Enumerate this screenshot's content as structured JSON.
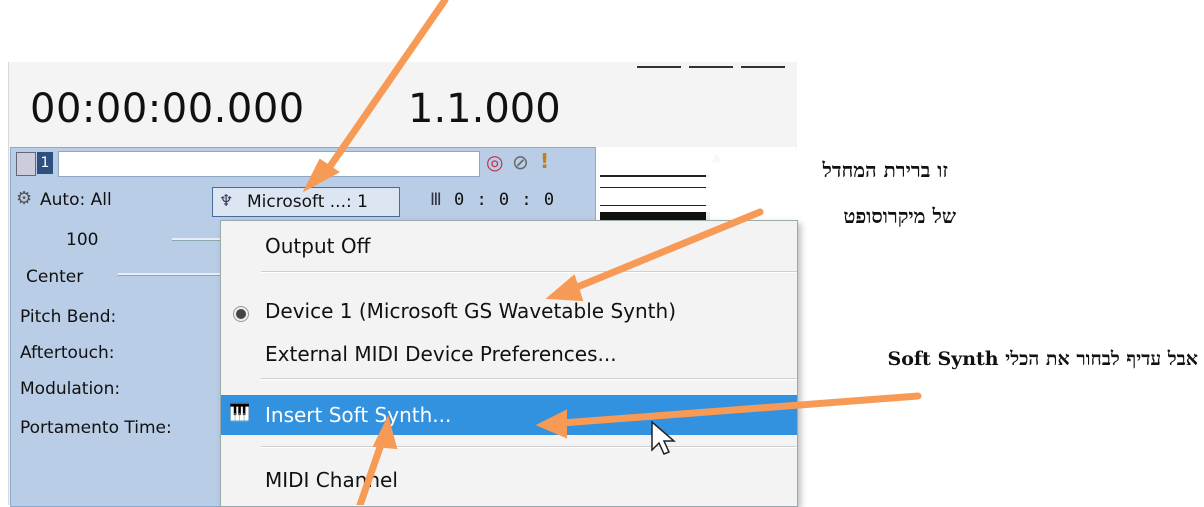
{
  "transport": {
    "time": "00:00:00.000",
    "measure": "1.1.000"
  },
  "track": {
    "auto_label": "Auto: All",
    "device_button": "Microsoft ...: 1",
    "counter": "0 : 0 : 0",
    "volume": "100",
    "pan": "Center",
    "params": [
      "Pitch Bend:",
      "Aftertouch:",
      "Modulation:",
      "Portamento Time:"
    ]
  },
  "menu": {
    "items": [
      {
        "label": "Output Off"
      },
      {
        "label": "Device 1  (Microsoft GS Wavetable Synth)"
      },
      {
        "label": "External MIDI Device Preferences..."
      },
      {
        "label": "Insert Soft Synth..."
      },
      {
        "label": "MIDI Channel"
      }
    ]
  },
  "annotations": {
    "line1": "זו ברירת המחדל",
    "line2": "של מיקרוסופט",
    "line3": "אבל עדיף לבחור את הכלי Soft Synth"
  },
  "colors": {
    "arrow": "#f79a55",
    "highlight": "#3392e0",
    "track_bg": "#b9cde6"
  }
}
